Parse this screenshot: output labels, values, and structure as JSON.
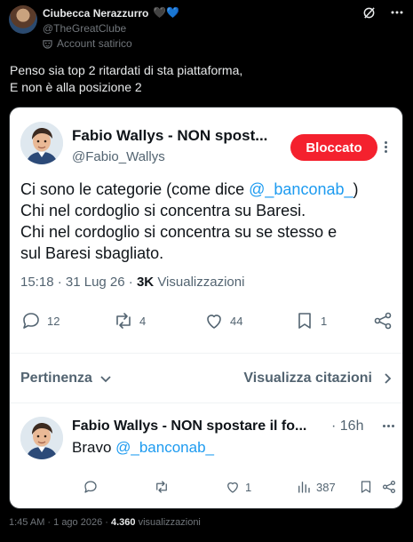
{
  "post": {
    "author_name": "Ciubecca Nerazzurro",
    "hearts": [
      "🖤",
      "💙"
    ],
    "handle": "@TheGreatClube",
    "label": "Account satirico",
    "text_lines": [
      "Penso sia top 2 ritardati di sta piattaforma,",
      "E non è alla posizione 2"
    ]
  },
  "quoted": {
    "author_name": "Fabio Wallys - NON spost...",
    "handle": "@Fabio_Wallys",
    "blocked_label": "Bloccato",
    "body": {
      "line1_prefix": "Ci sono le categorie (come dice ",
      "line1_mention": "@_banconab_",
      "line1_suffix": ")",
      "line2": "Chi nel cordoglio si concentra su Baresi.",
      "line3": "Chi nel cordoglio si concentra su se stesso e",
      "line4": "sul Baresi sbagliato."
    },
    "meta": {
      "time": "15:18",
      "sep1": " · ",
      "date": "31 Lug 26",
      "sep2": " · ",
      "views_count": "3K",
      "views_label": " Visualizzazioni"
    },
    "actions": {
      "replies": "12",
      "reposts": "4",
      "likes": "44",
      "bookmarks": "1"
    },
    "sort": {
      "label": "Pertinenza",
      "quotes_link": "Visualizza citazioni"
    },
    "reply": {
      "author_name": "Fabio Wallys - NON spostare il fo...",
      "time": "· 16h",
      "text_prefix": "Bravo ",
      "text_mention": "@_banconab_",
      "actions": {
        "likes": "1",
        "views": "387"
      }
    }
  },
  "footer": {
    "time": "1:45 AM",
    "sep": " · ",
    "date": "1 ago 2026",
    "sep2": " · ",
    "views_count": "4.360",
    "views_label": " visualizzazioni"
  },
  "colors": {
    "accent": "#1d9bf0",
    "blocked": "#f4212e",
    "bg": "#000000",
    "card_bg": "#ffffff"
  },
  "icons": [
    "mask-icon",
    "grok-icon",
    "more-icon",
    "reply-icon",
    "repost-icon",
    "like-icon",
    "bookmark-icon",
    "share-icon",
    "chevron-down-icon",
    "chevron-right-icon",
    "views-icon"
  ]
}
